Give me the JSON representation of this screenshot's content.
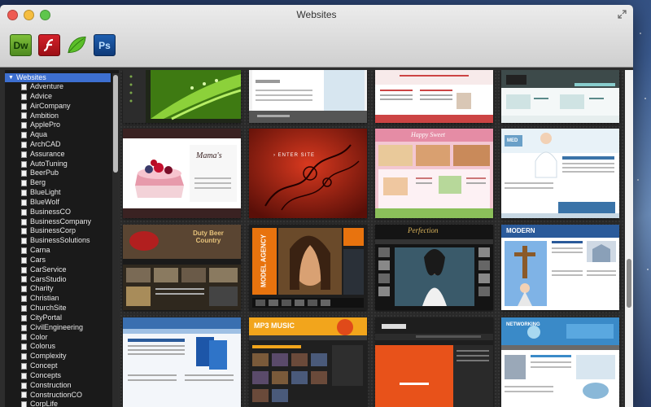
{
  "window": {
    "title": "Websites"
  },
  "toolbar": {
    "dreamweaver": {
      "label": "Dw"
    },
    "photoshop": {
      "label": "Ps"
    }
  },
  "sidebar": {
    "root": "Websites",
    "items": [
      "Adventure",
      "Advice",
      "AirCompany",
      "Ambition",
      "ApplePro",
      "Aqua",
      "ArchCAD",
      "Assurance",
      "AutoTuning",
      "BeerPub",
      "Berg",
      "BlueLight",
      "BlueWolf",
      "BusinessCO",
      "BusinessCompany",
      "BusinessCorp",
      "BusinessSolutions",
      "Carna",
      "Cars",
      "CarService",
      "CarsStudio",
      "Charity",
      "Christian",
      "ChurchSite",
      "CityPortal",
      "CivilEngineering",
      "Color",
      "Colorus",
      "Complexity",
      "Concept",
      "Concepts",
      "Construction",
      "ConstructionCO",
      "CorpLife"
    ]
  },
  "thumbnails": {
    "row1": [
      "Nature Grass Site",
      "Gray Business Site",
      "White Pink Site",
      "Teal Corporate Site"
    ],
    "row2": [
      "Cake Mama's",
      "Dark Red Swirl",
      "Bakery Cake Shop",
      "Medical Clinic"
    ],
    "row3": [
      "Duty Beer Country",
      "Model Agency",
      "Dark Perfection",
      "Modern Church"
    ],
    "row4": [
      "Blue Software",
      "MP3 Music",
      "Orange Dark Site",
      "Networking Blue"
    ],
    "labels": {
      "mama": "Mama's",
      "enter": "› ENTER SITE",
      "bakery": "Happy Sweet",
      "medical": "MED",
      "duty": "Duty Beer Country",
      "model": "MODEL AGENCY",
      "perfection": "Perfection",
      "modern": "MODERN",
      "mp3": "MP3 MUSIC",
      "networking": "NETWORKING"
    }
  }
}
